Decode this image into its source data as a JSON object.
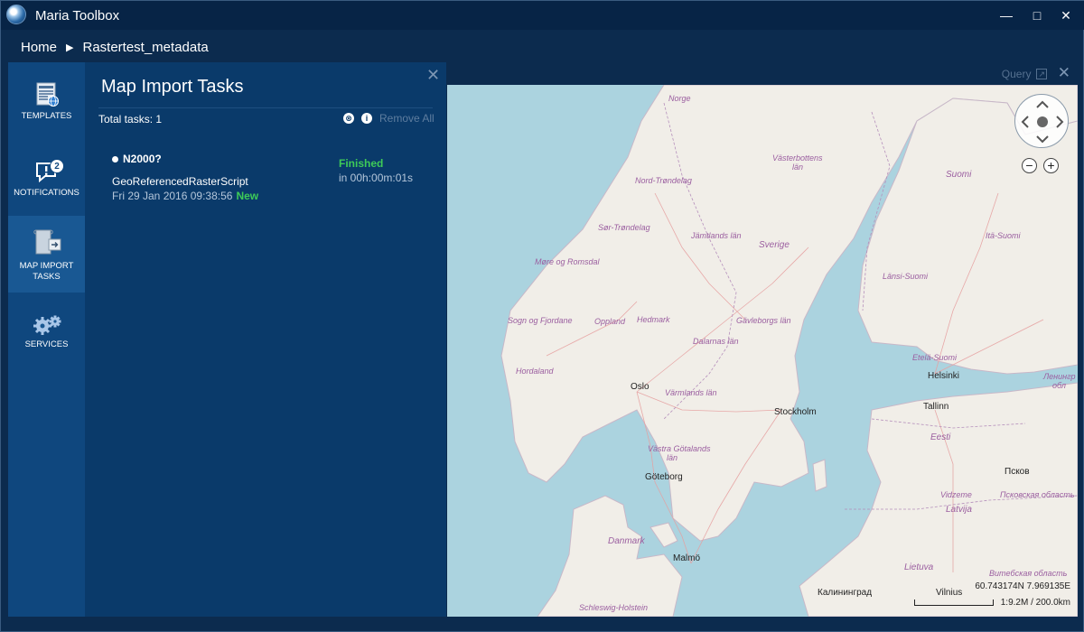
{
  "window": {
    "title": "Maria Toolbox",
    "minimize": "—",
    "maximize": "□",
    "close": "✕"
  },
  "breadcrumb": {
    "home": "Home",
    "separator": "▶",
    "current": "Rastertest_metadata"
  },
  "nav": {
    "items": [
      {
        "label": "TEMPLATES",
        "icon": "templates-icon"
      },
      {
        "label": "NOTIFICATIONS",
        "icon": "notifications-icon",
        "badge": "2"
      },
      {
        "label": "MAP IMPORT TASKS",
        "icon": "map-import-icon"
      },
      {
        "label": "SERVICES",
        "icon": "services-icon"
      }
    ]
  },
  "panel": {
    "title": "Map Import Tasks",
    "close": "✕",
    "total": "Total tasks: 1",
    "cancel_glyph": "⊗",
    "info_glyph": "i",
    "remove_all": "Remove All",
    "task": {
      "name": "N2000?",
      "script": "GeoReferencedRasterScript",
      "date": "Fri 29 Jan 2016 09:38:56",
      "new": "New",
      "status": "Finished",
      "duration": "in 00h:00m:01s"
    }
  },
  "map": {
    "query": "Query",
    "popout": "↗",
    "close": "✕",
    "zoom_out": "−",
    "zoom_in": "+",
    "coords": "60.743174N 7.969135E",
    "scale": "1:9.2M / 200.0km",
    "regions": [
      "Norge",
      "Västerbottens",
      "län",
      "Suomi",
      "Nord-Trøndelag",
      "Sør-Trøndelag",
      "Jämtlands län",
      "Sverige",
      "Itä-Suomi",
      "Møre og Romsdal",
      "Länsi-Suomi",
      "Sogn og Fjordane",
      "Oppland",
      "Hedmark",
      "Gävleborgs län",
      "Dalarnas län",
      "Etelä-Suomi",
      "Hordaland",
      "Värmlands län",
      "Ленингр",
      "обл",
      "Västra Götalands",
      "län",
      "Eesti",
      "Vidzeme",
      "Псковская область",
      "Latvija",
      "Danmark",
      "Lietuva",
      "Витебская область",
      "Schleswig-Holstein"
    ],
    "cities": [
      "Oslo",
      "Stockholm",
      "Helsinki",
      "Tallinn",
      "Göteborg",
      "Псков",
      "Malmö",
      "Калининград",
      "Vilnius"
    ]
  }
}
